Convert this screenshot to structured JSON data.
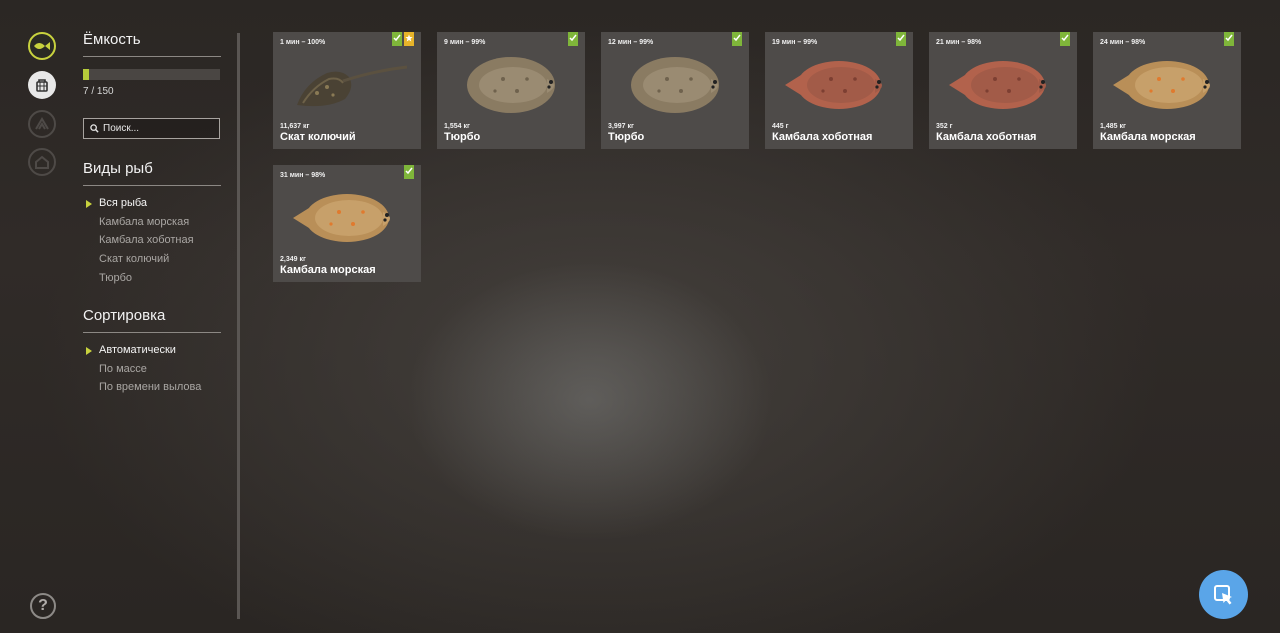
{
  "rail": {
    "icons": [
      "fish-net-icon",
      "keepnet-icon",
      "tackle-icon",
      "home-icon"
    ],
    "help_label": "?"
  },
  "capacity": {
    "title": "Ёмкость",
    "current": 7,
    "max": 150,
    "text": "7 / 150"
  },
  "search": {
    "placeholder": "Поиск..."
  },
  "species": {
    "title": "Виды рыб",
    "options": [
      "Вся рыба",
      "Камбала морская",
      "Камбала хоботная",
      "Скат колючий",
      "Тюрбо"
    ],
    "selected_index": 0
  },
  "sort": {
    "title": "Сортировка",
    "options": [
      "Автоматически",
      "По массе",
      "По времени вылова"
    ],
    "selected_index": 0
  },
  "fish": [
    {
      "time": "1 мин – 100%",
      "weight": "11,637 кг",
      "name": "Скат колючий",
      "kind": "ray",
      "badges": [
        "green",
        "yellow"
      ]
    },
    {
      "time": "9 мин – 99%",
      "weight": "1,554 кг",
      "name": "Тюрбо",
      "kind": "turbot",
      "badges": [
        "green"
      ]
    },
    {
      "time": "12 мин – 99%",
      "weight": "3,997 кг",
      "name": "Тюрбо",
      "kind": "turbot",
      "badges": [
        "green"
      ]
    },
    {
      "time": "19 мин – 99%",
      "weight": "445 г",
      "name": "Камбала хоботная",
      "kind": "flounder-red",
      "badges": [
        "green"
      ]
    },
    {
      "time": "21 мин – 98%",
      "weight": "352 г",
      "name": "Камбала хоботная",
      "kind": "flounder-red",
      "badges": [
        "green"
      ]
    },
    {
      "time": "24 мин – 98%",
      "weight": "1,485 кг",
      "name": "Камбала морская",
      "kind": "plaice",
      "badges": [
        "green"
      ]
    },
    {
      "time": "31 мин – 98%",
      "weight": "2,349 кг",
      "name": "Камбала морская",
      "kind": "plaice",
      "badges": [
        "green"
      ]
    }
  ],
  "colors": {
    "accent": "#c8d23e",
    "badge_green": "#7fb63a",
    "badge_yellow": "#e7b42a",
    "card_bg": "#4e4b49",
    "fab": "#5aa5e8"
  }
}
